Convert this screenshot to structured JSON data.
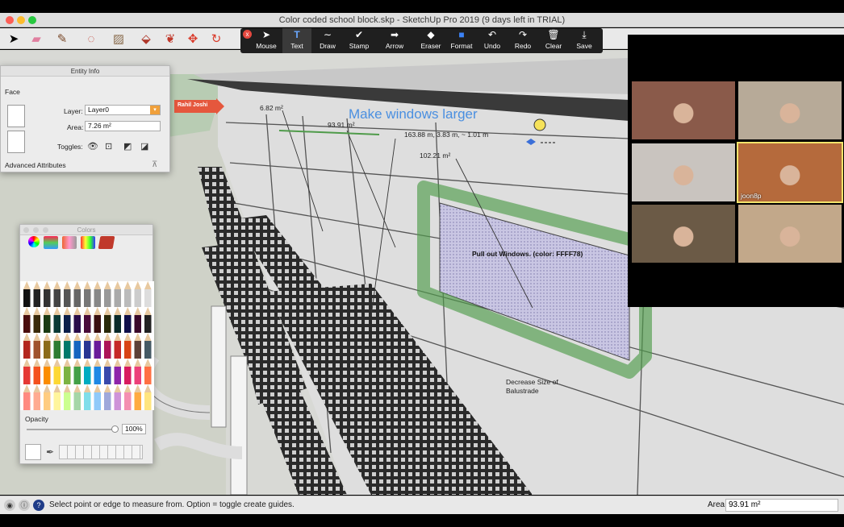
{
  "window": {
    "title": "Color coded school block.skp - SketchUp Pro 2019 (9 days left in TRIAL)"
  },
  "toolbar": {
    "tools": [
      "select-icon",
      "eraser-icon",
      "pencil-icon",
      "shapes-icon",
      "paint-bucket-icon",
      "push-pull-icon",
      "follow-me-icon",
      "move-icon",
      "rotate-icon"
    ]
  },
  "annotation": {
    "close": "x",
    "buttons": [
      {
        "label": "Mouse",
        "icon": "➤"
      },
      {
        "label": "Text",
        "icon": "T"
      },
      {
        "label": "Draw",
        "icon": "∼"
      },
      {
        "label": "Stamp",
        "icon": "✔"
      },
      {
        "label": "Arrow",
        "icon": "➡"
      },
      {
        "label": "Eraser",
        "icon": "◆"
      },
      {
        "label": "Format",
        "icon": "■"
      },
      {
        "label": "Undo",
        "icon": "↶"
      },
      {
        "label": "Redo",
        "icon": "↷"
      },
      {
        "label": "Clear",
        "icon": "🗑"
      },
      {
        "label": "Save",
        "icon": "⤓"
      }
    ],
    "active": "Text"
  },
  "entity_info": {
    "title": "Entity Info",
    "type": "Face",
    "layer_label": "Layer:",
    "layer_value": "Layer0",
    "area_label": "Area:",
    "area_value": "7.26 m²",
    "toggles_label": "Toggles:",
    "advanced": "Advanced Attributes"
  },
  "colors_panel": {
    "title": "Colors",
    "opacity_label": "Opacity",
    "opacity_value": "100%"
  },
  "model_annotations": {
    "user_tag": "Rahil Joshi",
    "headline": "Make windows larger",
    "dim1": "6.82 m²",
    "dim2": "93.91 m²",
    "dim3": "163.88 m, 3.83 m, ~ 1.01 m",
    "dim4": "102.21 m²",
    "note1": "Pull out Windows. (color: FFFF78)",
    "note2a": "Decrease Size of",
    "note2b": "Balustrade"
  },
  "gallery": {
    "participants": [
      {
        "name": "",
        "bg": "#8a5a4a"
      },
      {
        "name": "",
        "bg": "#b7aa98"
      },
      {
        "name": "",
        "bg": "#c9c4bf"
      },
      {
        "name": "joon8p",
        "bg": "#b56a3c"
      },
      {
        "name": "",
        "bg": "#6b5a46"
      },
      {
        "name": "",
        "bg": "#c2a88a"
      }
    ]
  },
  "status": {
    "text": "Select point or edge to measure from.  Option = toggle create guides.",
    "vcb_label": "Area",
    "vcb_value": "93.91 m²"
  },
  "colors": {
    "highlight": "#FFFF78",
    "green_marker": "#4f9b4a",
    "blue_text": "#4a8fe0",
    "tag_red": "#e5573d"
  }
}
